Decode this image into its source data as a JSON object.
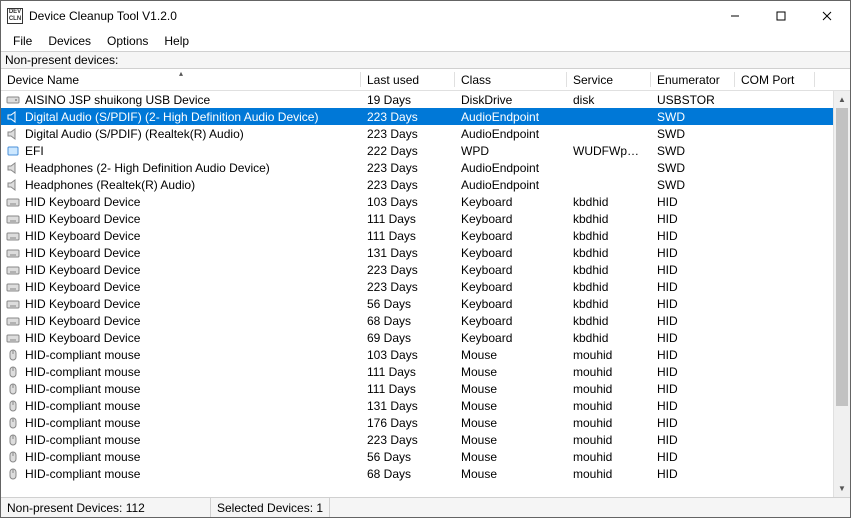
{
  "window": {
    "title": "Device Cleanup Tool V1.2.0",
    "app_icon_text": "DEV\nCLN"
  },
  "menu": {
    "items": [
      "File",
      "Devices",
      "Options",
      "Help"
    ]
  },
  "subheader": {
    "label": "Non-present devices:"
  },
  "columns": {
    "name": "Device Name",
    "last": "Last used",
    "class": "Class",
    "svc": "Service",
    "enum": "Enumerator",
    "com": "COM Port",
    "sort_indicator": "▴"
  },
  "selected_index": 1,
  "devices": [
    {
      "icon": "disk",
      "name": "AISINO JSP shuikong USB Device",
      "last": "19 Days",
      "class": "DiskDrive",
      "svc": "disk",
      "enum": "USBSTOR",
      "com": ""
    },
    {
      "icon": "audio",
      "name": "Digital Audio (S/PDIF) (2- High Definition Audio Device)",
      "last": "223 Days",
      "class": "AudioEndpoint",
      "svc": "",
      "enum": "SWD",
      "com": ""
    },
    {
      "icon": "audio",
      "name": "Digital Audio (S/PDIF) (Realtek(R) Audio)",
      "last": "223 Days",
      "class": "AudioEndpoint",
      "svc": "",
      "enum": "SWD",
      "com": ""
    },
    {
      "icon": "generic",
      "name": "EFI",
      "last": "222 Days",
      "class": "WPD",
      "svc": "WUDFWpdFs",
      "enum": "SWD",
      "com": ""
    },
    {
      "icon": "audio",
      "name": "Headphones (2- High Definition Audio Device)",
      "last": "223 Days",
      "class": "AudioEndpoint",
      "svc": "",
      "enum": "SWD",
      "com": ""
    },
    {
      "icon": "audio",
      "name": "Headphones (Realtek(R) Audio)",
      "last": "223 Days",
      "class": "AudioEndpoint",
      "svc": "",
      "enum": "SWD",
      "com": ""
    },
    {
      "icon": "keyboard",
      "name": "HID Keyboard Device",
      "last": "103 Days",
      "class": "Keyboard",
      "svc": "kbdhid",
      "enum": "HID",
      "com": ""
    },
    {
      "icon": "keyboard",
      "name": "HID Keyboard Device",
      "last": "111 Days",
      "class": "Keyboard",
      "svc": "kbdhid",
      "enum": "HID",
      "com": ""
    },
    {
      "icon": "keyboard",
      "name": "HID Keyboard Device",
      "last": "111 Days",
      "class": "Keyboard",
      "svc": "kbdhid",
      "enum": "HID",
      "com": ""
    },
    {
      "icon": "keyboard",
      "name": "HID Keyboard Device",
      "last": "131 Days",
      "class": "Keyboard",
      "svc": "kbdhid",
      "enum": "HID",
      "com": ""
    },
    {
      "icon": "keyboard",
      "name": "HID Keyboard Device",
      "last": "223 Days",
      "class": "Keyboard",
      "svc": "kbdhid",
      "enum": "HID",
      "com": ""
    },
    {
      "icon": "keyboard",
      "name": "HID Keyboard Device",
      "last": "223 Days",
      "class": "Keyboard",
      "svc": "kbdhid",
      "enum": "HID",
      "com": ""
    },
    {
      "icon": "keyboard",
      "name": "HID Keyboard Device",
      "last": "56 Days",
      "class": "Keyboard",
      "svc": "kbdhid",
      "enum": "HID",
      "com": ""
    },
    {
      "icon": "keyboard",
      "name": "HID Keyboard Device",
      "last": "68 Days",
      "class": "Keyboard",
      "svc": "kbdhid",
      "enum": "HID",
      "com": ""
    },
    {
      "icon": "keyboard",
      "name": "HID Keyboard Device",
      "last": "69 Days",
      "class": "Keyboard",
      "svc": "kbdhid",
      "enum": "HID",
      "com": ""
    },
    {
      "icon": "mouse",
      "name": "HID-compliant mouse",
      "last": "103 Days",
      "class": "Mouse",
      "svc": "mouhid",
      "enum": "HID",
      "com": ""
    },
    {
      "icon": "mouse",
      "name": "HID-compliant mouse",
      "last": "111 Days",
      "class": "Mouse",
      "svc": "mouhid",
      "enum": "HID",
      "com": ""
    },
    {
      "icon": "mouse",
      "name": "HID-compliant mouse",
      "last": "111 Days",
      "class": "Mouse",
      "svc": "mouhid",
      "enum": "HID",
      "com": ""
    },
    {
      "icon": "mouse",
      "name": "HID-compliant mouse",
      "last": "131 Days",
      "class": "Mouse",
      "svc": "mouhid",
      "enum": "HID",
      "com": ""
    },
    {
      "icon": "mouse",
      "name": "HID-compliant mouse",
      "last": "176 Days",
      "class": "Mouse",
      "svc": "mouhid",
      "enum": "HID",
      "com": ""
    },
    {
      "icon": "mouse",
      "name": "HID-compliant mouse",
      "last": "223 Days",
      "class": "Mouse",
      "svc": "mouhid",
      "enum": "HID",
      "com": ""
    },
    {
      "icon": "mouse",
      "name": "HID-compliant mouse",
      "last": "56 Days",
      "class": "Mouse",
      "svc": "mouhid",
      "enum": "HID",
      "com": ""
    },
    {
      "icon": "mouse",
      "name": "HID-compliant mouse",
      "last": "68 Days",
      "class": "Mouse",
      "svc": "mouhid",
      "enum": "HID",
      "com": ""
    }
  ],
  "icons": {
    "disk": "disk-drive-icon",
    "audio": "audio-icon",
    "generic": "generic-device-icon",
    "keyboard": "keyboard-icon",
    "mouse": "mouse-icon"
  },
  "statusbar": {
    "nonpresent": "Non-present Devices: 112",
    "selected": "Selected Devices: 1"
  }
}
